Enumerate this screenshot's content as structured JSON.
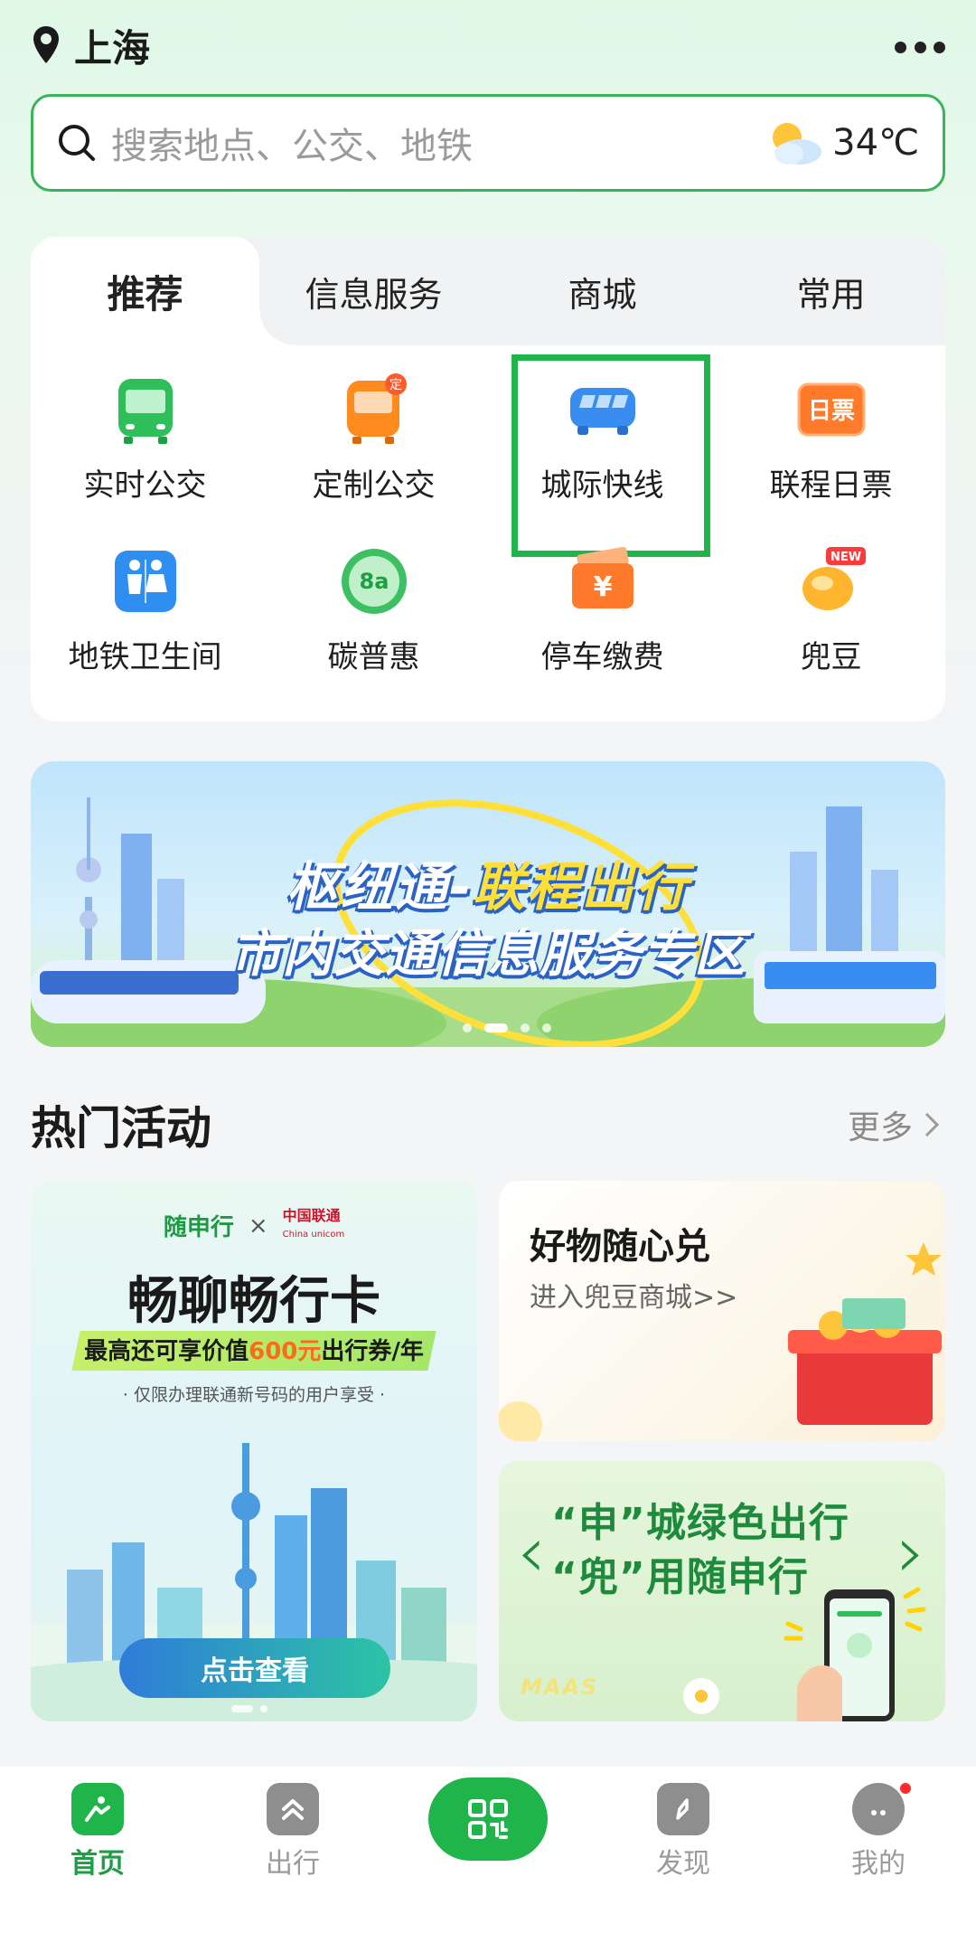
{
  "header": {
    "city": "上海",
    "more_icon": "ellipsis-icon"
  },
  "search": {
    "placeholder": "搜索地点、公交、地铁",
    "temperature": "34℃",
    "weather_icon": "partly-cloudy-icon"
  },
  "services": {
    "tabs": [
      {
        "label": "推荐",
        "active": true
      },
      {
        "label": "信息服务"
      },
      {
        "label": "商城"
      },
      {
        "label": "常用"
      }
    ],
    "items": [
      {
        "label": "实时公交",
        "icon": "bus-icon",
        "color": "#2fbf5a"
      },
      {
        "label": "定制公交",
        "icon": "custom-bus-icon",
        "color": "#ff8a1e",
        "badge": "定"
      },
      {
        "label": "城际快线",
        "icon": "intercity-coach-icon",
        "color": "#3a8df0",
        "highlighted": true
      },
      {
        "label": "联程日票",
        "icon": "day-ticket-icon",
        "color": "#ff7a2a",
        "icon_text": "日票"
      },
      {
        "label": "地铁卫生间",
        "icon": "restroom-icon",
        "color": "#2f8ff0"
      },
      {
        "label": "碳普惠",
        "icon": "carbon-coin-icon",
        "color": "#3dbf63",
        "icon_text": "8a"
      },
      {
        "label": "停车缴费",
        "icon": "parking-payment-icon",
        "color": "#ff7a2a",
        "icon_text": "¥"
      },
      {
        "label": "兜豆",
        "icon": "doudou-bean-icon",
        "color": "#ffb52e",
        "badge": "NEW"
      }
    ]
  },
  "banner": {
    "line1_a": "枢纽通-",
    "line1_b": "联程出行",
    "line2": "市内交通信息服务专区",
    "slides": 4,
    "active_slide": 1
  },
  "hot": {
    "title": "热门活动",
    "more": "更多",
    "left": {
      "brand_a": "随申行",
      "times": "×",
      "brand_b": "中国联通",
      "brand_b_en": "China unicom",
      "title": "畅聊畅行卡",
      "sub_a": "最高还可享价值",
      "sub_amount": "600元",
      "sub_b": "出行券/年",
      "note": "· 仅限办理联通新号码的用户享受 ·",
      "button": "点击查看"
    },
    "right_top": {
      "title": "好物随心兑",
      "sub": "进入兜豆商城>>"
    },
    "right_bottom": {
      "line1": "“申”城绿色出行",
      "line2": "“兜”用随申行",
      "tag": "MAAS"
    }
  },
  "nav": [
    {
      "label": "首页",
      "icon": "home-icon",
      "active": true
    },
    {
      "label": "出行",
      "icon": "travel-icon"
    },
    {
      "label": "",
      "icon": "scan-qr-icon"
    },
    {
      "label": "发现",
      "icon": "discover-icon"
    },
    {
      "label": "我的",
      "icon": "profile-icon",
      "dot": true
    }
  ]
}
